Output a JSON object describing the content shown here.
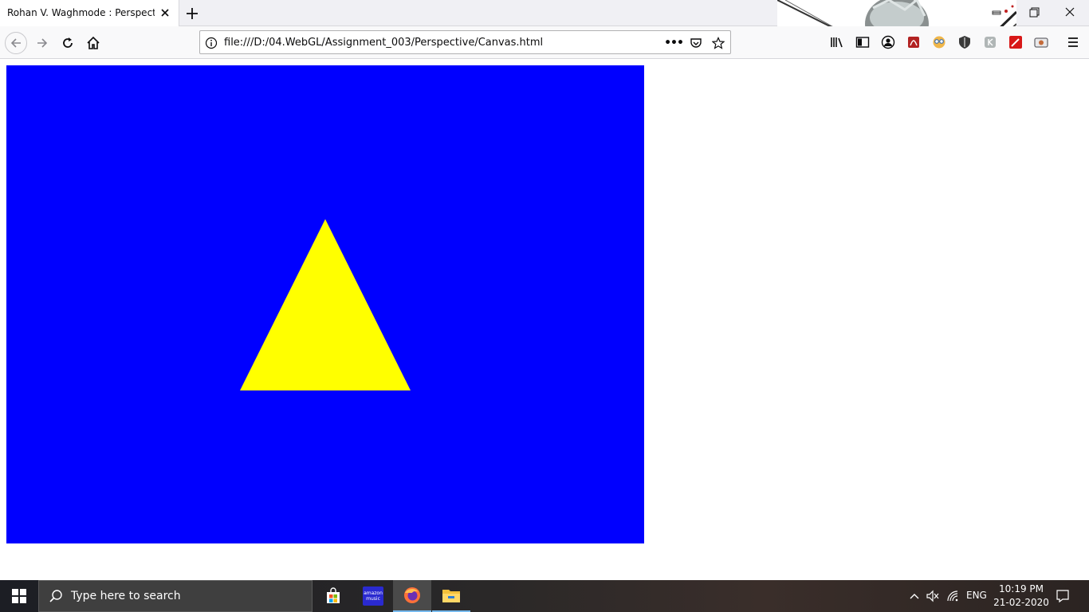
{
  "browser": {
    "tab": {
      "title": "Rohan V. Waghmode : Perspective",
      "close_icon": "close-icon"
    },
    "new_tab_icon": "plus-icon",
    "url": "file:///D:/04.WebGL/Assignment_003/Perspective/Canvas.html",
    "more_icon": "•••",
    "window_controls": [
      "minimize-icon",
      "restore-icon",
      "close-icon"
    ]
  },
  "canvas": {
    "background_color": "#0000ff",
    "shape": "triangle",
    "shape_color": "#ffff00"
  },
  "taskbar": {
    "search_placeholder": "Type here to search",
    "amazon_line1": "amazon",
    "amazon_line2": "music",
    "language": "ENG",
    "time": "10:19 PM",
    "date": "21-02-2020"
  }
}
